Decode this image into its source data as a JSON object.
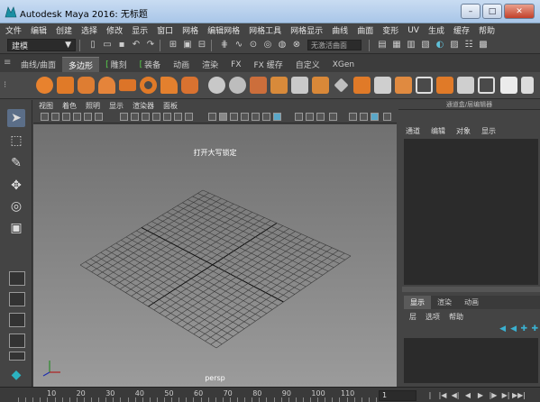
{
  "window": {
    "title": "Autodesk Maya 2016: 无标题",
    "minimize": "–",
    "maximize": "□",
    "close": "✕"
  },
  "menubar": {
    "items": [
      "文件",
      "编辑",
      "创建",
      "选择",
      "修改",
      "显示",
      "窗口",
      "网格",
      "编辑网格",
      "网格工具",
      "网格显示",
      "曲线",
      "曲面",
      "变形",
      "UV",
      "生成",
      "缓存",
      "帮助"
    ]
  },
  "statusline": {
    "mode": "建模",
    "live_surface": "无激活曲面"
  },
  "shelf": {
    "tabs": [
      "曲线/曲面",
      "多边形",
      "雕刻",
      "装备",
      "动画",
      "渲染",
      "FX",
      "FX 缓存",
      "自定义",
      "XGen"
    ],
    "active_tab": "多边形"
  },
  "viewport": {
    "menu": [
      "视图",
      "着色",
      "照明",
      "显示",
      "渲染器",
      "面板"
    ],
    "hint": "打开大写锁定",
    "camera": "persp",
    "colors": {
      "background_top": "#707070",
      "background_bottom": "#9b9b9b",
      "grid": "#3a3a3a",
      "axis": "#111111"
    }
  },
  "channelbox": {
    "header": "通道盒/层编辑器",
    "menu": [
      "通道",
      "编辑",
      "对象",
      "显示"
    ]
  },
  "layers": {
    "tabs": [
      "显示",
      "渲染",
      "动画"
    ],
    "active_tab": "显示",
    "menu": [
      "层",
      "选项",
      "帮助"
    ]
  },
  "timeline": {
    "ticks": [
      "10",
      "20",
      "30",
      "40",
      "50",
      "60",
      "70",
      "80",
      "90",
      "100",
      "110"
    ],
    "current_frame": "1"
  }
}
